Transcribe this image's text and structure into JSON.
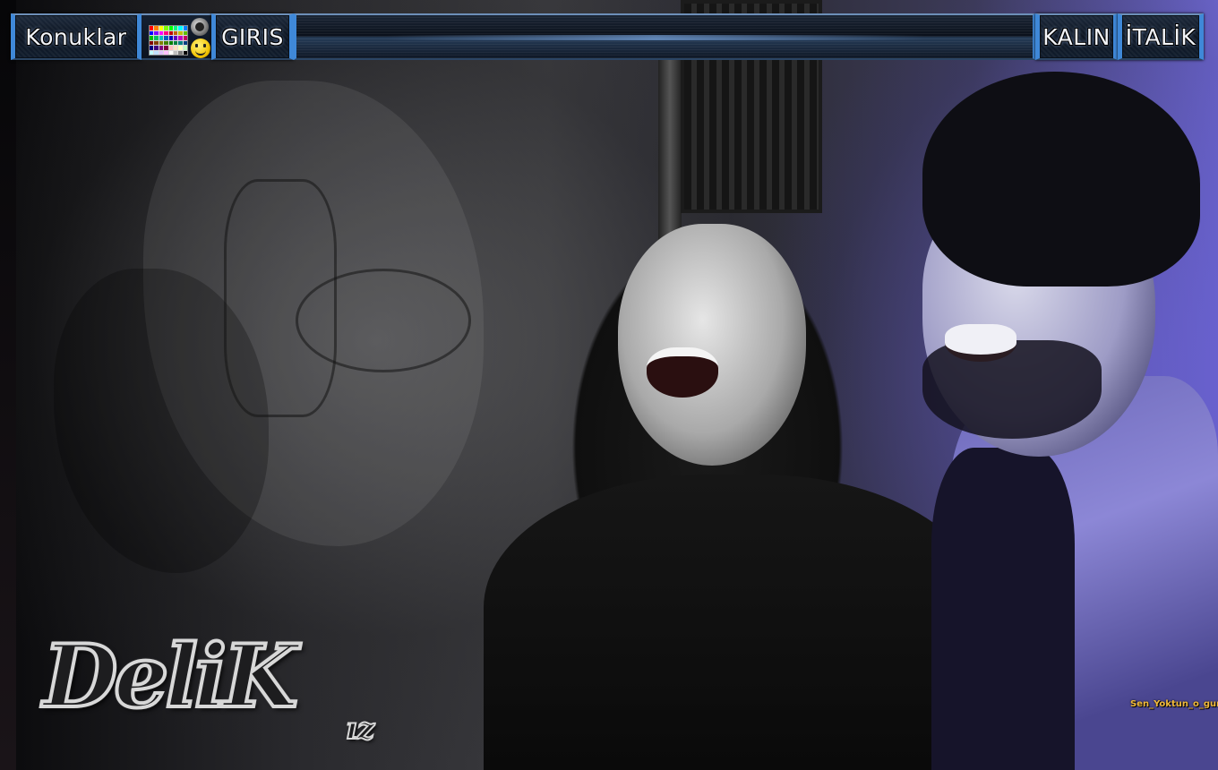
{
  "toolbar": {
    "guests_label": "Konuklar",
    "login_label": "GIRIS",
    "bold_label": "KALIN",
    "italic_label": "İTALİK",
    "message_value": "",
    "message_placeholder": ""
  },
  "icons": {
    "color_palette": "color-palette-icon",
    "smiley_settings": "gray-smiley-icon",
    "smiley_emoji": "yellow-smiley-icon"
  },
  "palette_colors": [
    "#ff0000",
    "#ff8000",
    "#ffff00",
    "#80ff00",
    "#00ff00",
    "#00ff80",
    "#00ffff",
    "#0080ff",
    "#0000ff",
    "#8000ff",
    "#ff00ff",
    "#ff0080",
    "#c00000",
    "#c06000",
    "#c0c000",
    "#60c000",
    "#00c000",
    "#00c060",
    "#00c0c0",
    "#0060c0",
    "#0000c0",
    "#6000c0",
    "#c000c0",
    "#c00060",
    "#800000",
    "#804000",
    "#808000",
    "#408000",
    "#008000",
    "#008040",
    "#008080",
    "#004080",
    "#000080",
    "#400080",
    "#800080",
    "#800040",
    "#ffc0c0",
    "#ffe0c0",
    "#ffffc0",
    "#c0ffc0",
    "#c0ffff",
    "#c0e0ff",
    "#e0c0ff",
    "#ffc0ff",
    "#ffffff",
    "#c0c0c0",
    "#808080",
    "#000000"
  ],
  "logo": {
    "main": "DeliK",
    "suffix": "ız"
  },
  "watermark": "Sen_Yoktun_o_gun",
  "colors": {
    "accent_blue": "#3f88d8",
    "bar_dark": "#0d1522",
    "watermark_gold": "#f0b93a"
  }
}
